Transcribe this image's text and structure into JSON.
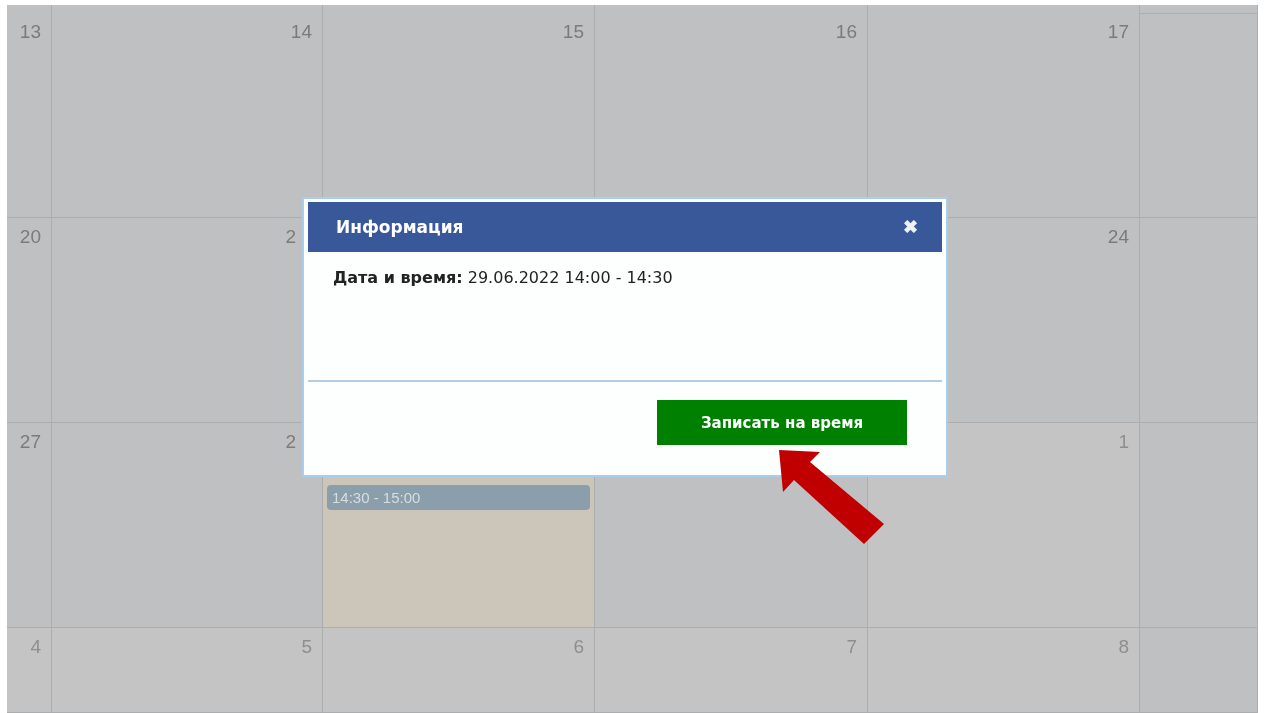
{
  "calendar": {
    "weeks": [
      {
        "days": [
          {
            "kind": "blank"
          },
          {
            "kind": "blank"
          },
          {
            "kind": "blank"
          },
          {
            "kind": "blank"
          },
          {
            "kind": "blank"
          },
          {
            "kind": "blank"
          }
        ]
      },
      {
        "days": [
          {
            "kind": "day",
            "day": "13",
            "other_month": false
          },
          {
            "kind": "day",
            "day": "14",
            "other_month": false
          },
          {
            "kind": "day",
            "day": "15",
            "other_month": false
          },
          {
            "kind": "day",
            "day": "16",
            "other_month": false
          },
          {
            "kind": "day",
            "day": "17",
            "other_month": false
          },
          {
            "kind": "blank"
          }
        ]
      },
      {
        "days": [
          {
            "kind": "day",
            "day": "20",
            "other_month": false
          },
          {
            "kind": "partial",
            "day": "2",
            "other_month": false
          },
          {
            "kind": "blank"
          },
          {
            "kind": "blank"
          },
          {
            "kind": "day",
            "day": "24",
            "other_month": false
          },
          {
            "kind": "blank"
          }
        ]
      },
      {
        "days": [
          {
            "kind": "day",
            "day": "27",
            "other_month": false
          },
          {
            "kind": "partial",
            "day": "2",
            "other_month": false
          },
          {
            "kind": "events",
            "highlighted": true,
            "events": [
              {
                "time": "14:30 - 15:00"
              }
            ]
          },
          {
            "kind": "blank"
          },
          {
            "kind": "day",
            "day": "1",
            "other_month": true
          },
          {
            "kind": "blank"
          }
        ]
      },
      {
        "days": [
          {
            "kind": "day",
            "day": "4",
            "other_month": true
          },
          {
            "kind": "day",
            "day": "5",
            "other_month": true
          },
          {
            "kind": "day",
            "day": "6",
            "other_month": true
          },
          {
            "kind": "day",
            "day": "7",
            "other_month": true
          },
          {
            "kind": "day",
            "day": "8",
            "other_month": true
          },
          {
            "kind": "blank"
          }
        ]
      }
    ]
  },
  "dialog": {
    "title": "Информация",
    "close": "✖",
    "label": "Дата и время:",
    "value": "29.06.2022 14:00 - 14:30",
    "button": "Записать на время"
  }
}
